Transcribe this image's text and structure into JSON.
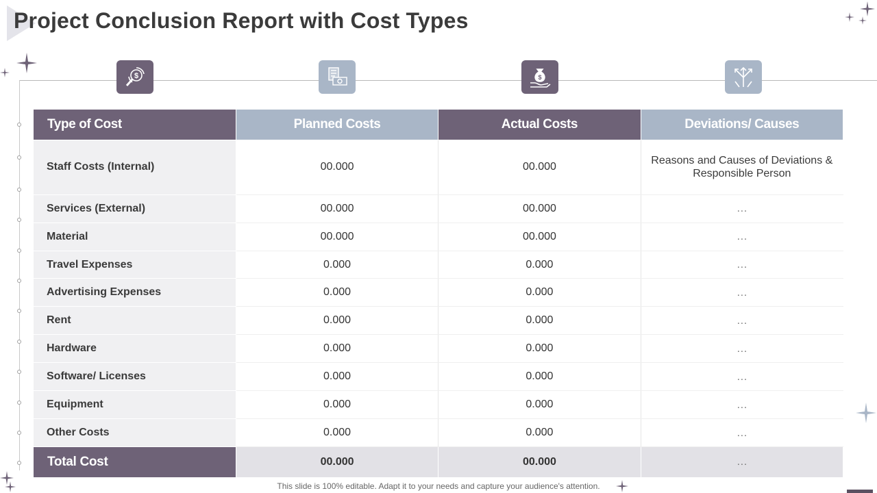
{
  "title": "Project Conclusion Report with Cost Types",
  "icons": [
    {
      "name": "money-search-icon",
      "variant": "dark"
    },
    {
      "name": "invoice-cash-icon",
      "variant": "light"
    },
    {
      "name": "money-bag-hand-icon",
      "variant": "dark"
    },
    {
      "name": "diverging-arrows-icon",
      "variant": "light"
    }
  ],
  "table": {
    "headers": [
      "Type of Cost",
      "Planned Costs",
      "Actual Costs",
      "Deviations/ Causes"
    ],
    "rows": [
      {
        "type": "Staff Costs (Internal)",
        "planned": "00.000",
        "actual": "00.000",
        "deviation": "Reasons and Causes of Deviations & Responsible Person"
      },
      {
        "type": "Services (External)",
        "planned": "00.000",
        "actual": "00.000",
        "deviation": "…"
      },
      {
        "type": "Material",
        "planned": "00.000",
        "actual": "00.000",
        "deviation": "…"
      },
      {
        "type": "Travel Expenses",
        "planned": "0.000",
        "actual": "0.000",
        "deviation": "…"
      },
      {
        "type": "Advertising Expenses",
        "planned": "0.000",
        "actual": "0.000",
        "deviation": "…"
      },
      {
        "type": "Rent",
        "planned": "0.000",
        "actual": "0.000",
        "deviation": "…"
      },
      {
        "type": "Hardware",
        "planned": "0.000",
        "actual": "0.000",
        "deviation": "…"
      },
      {
        "type": "Software/ Licenses",
        "planned": "0.000",
        "actual": "0.000",
        "deviation": "…"
      },
      {
        "type": "Equipment",
        "planned": "0.000",
        "actual": "0.000",
        "deviation": "…"
      },
      {
        "type": "Other Costs",
        "planned": "0.000",
        "actual": "0.000",
        "deviation": "…"
      }
    ],
    "total": {
      "type": "Total Cost",
      "planned": "00.000",
      "actual": "00.000",
      "deviation": "…"
    }
  },
  "footer": "This slide is 100% editable. Adapt it to your needs and capture your audience's attention.",
  "colors": {
    "accent_dark": "#6e6277",
    "accent_light": "#a9b6c7",
    "row_bg": "#f0f0f2",
    "total_bg": "#e2e1e6"
  }
}
